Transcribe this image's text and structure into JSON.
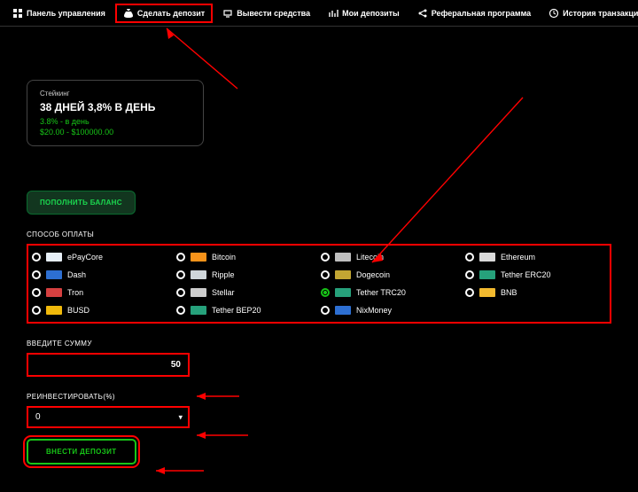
{
  "nav": {
    "dashboard": "Панель управления",
    "deposit": "Сделать депозит",
    "withdraw": "Вывести средства",
    "my_deposits": "Мои депозиты",
    "referral": "Реферальная программа",
    "history": "История транзакций"
  },
  "plan": {
    "label": "Стейкинг",
    "title": "38 ДНЕЙ 3,8% В ДЕНЬ",
    "rate": "3.8% - в день",
    "range": "$20.00 - $100000.00"
  },
  "buttons": {
    "topup": "ПОПОЛНИТЬ БАЛАНС",
    "make_deposit": "ВНЕСТИ ДЕПОЗИТ"
  },
  "labels": {
    "payment_method": "СПОСОБ ОПЛАТЫ",
    "enter_amount": "ВВЕДИТЕ СУММУ",
    "reinvest": "РЕИНВЕСТИРОВАТЬ(%)"
  },
  "payment_methods": [
    {
      "name": "ePayCore",
      "selected": false,
      "logo_bg": "#e6eef6"
    },
    {
      "name": "Bitcoin",
      "selected": false,
      "logo_bg": "#f7931a"
    },
    {
      "name": "Litecoin",
      "selected": false,
      "logo_bg": "#bfbfbf"
    },
    {
      "name": "Ethereum",
      "selected": false,
      "logo_bg": "#d9d9d9"
    },
    {
      "name": "Dash",
      "selected": false,
      "logo_bg": "#2d6fd2"
    },
    {
      "name": "Ripple",
      "selected": false,
      "logo_bg": "#cfd6da"
    },
    {
      "name": "Dogecoin",
      "selected": false,
      "logo_bg": "#c2a633"
    },
    {
      "name": "Tether ERC20",
      "selected": false,
      "logo_bg": "#26a17b"
    },
    {
      "name": "Tron",
      "selected": false,
      "logo_bg": "#d64040"
    },
    {
      "name": "Stellar",
      "selected": false,
      "logo_bg": "#cccccc"
    },
    {
      "name": "Tether TRC20",
      "selected": true,
      "logo_bg": "#26a17b"
    },
    {
      "name": "BNB",
      "selected": false,
      "logo_bg": "#f3ba2f"
    },
    {
      "name": "BUSD",
      "selected": false,
      "logo_bg": "#f0b90b"
    },
    {
      "name": "Tether BEP20",
      "selected": false,
      "logo_bg": "#26a17b"
    },
    {
      "name": "NixMoney",
      "selected": false,
      "logo_bg": "#2d6fd2"
    }
  ],
  "form": {
    "amount_value": "50",
    "reinvest_value": "0"
  }
}
